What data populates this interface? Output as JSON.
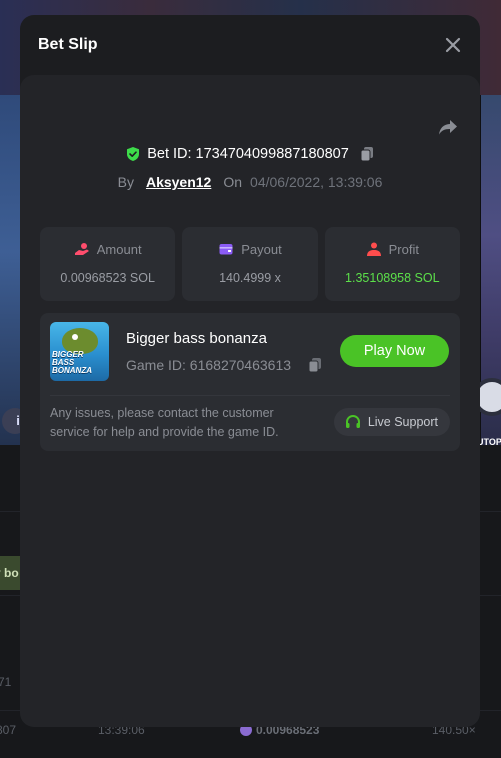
{
  "modal": {
    "title": "Bet Slip"
  },
  "bet": {
    "id_label": "Bet ID:",
    "id": "1734704099887180807",
    "by_label": "By",
    "user": "Aksyen12",
    "on_label": "On",
    "datetime": "04/06/2022, 13:39:06"
  },
  "stats": [
    {
      "label": "Amount",
      "value": "0.00968523 SOL",
      "icon": "coins-hand-icon",
      "icon_color": "#ff4d6d"
    },
    {
      "label": "Payout",
      "value": "140.4999 x",
      "icon": "wallet-icon",
      "icon_color": "#8b5cf6"
    },
    {
      "label": "Profit",
      "value": "1.35108958 SOL",
      "icon": "person-coins-icon",
      "icon_color": "#ff4d4d",
      "value_color": "#5ce04a"
    }
  ],
  "game": {
    "name": "Bigger bass bonanza",
    "thumb_title": "BIGGER BASS BONANZA",
    "id_label": "Game ID:",
    "id": "6168270463613",
    "play_label": "Play Now",
    "issue_text": "Any issues, please contact the customer service for help and provide the game ID.",
    "support_label": "Live Support"
  },
  "background": {
    "chip_text": "y bo",
    "left_icon_text": "i",
    "autoplay_text": "UTOP",
    "row_text": "71",
    "bottom_row": {
      "col1": "807",
      "col2": "13:39:06",
      "col3": "0.00968523",
      "col4": "140.50×"
    }
  },
  "colors": {
    "accent_green": "#4ac326",
    "profit_green": "#5ce04a",
    "shield_green": "#3ddc4a",
    "modal_bg": "#1c1d20",
    "card_bg": "#2b2d32"
  }
}
